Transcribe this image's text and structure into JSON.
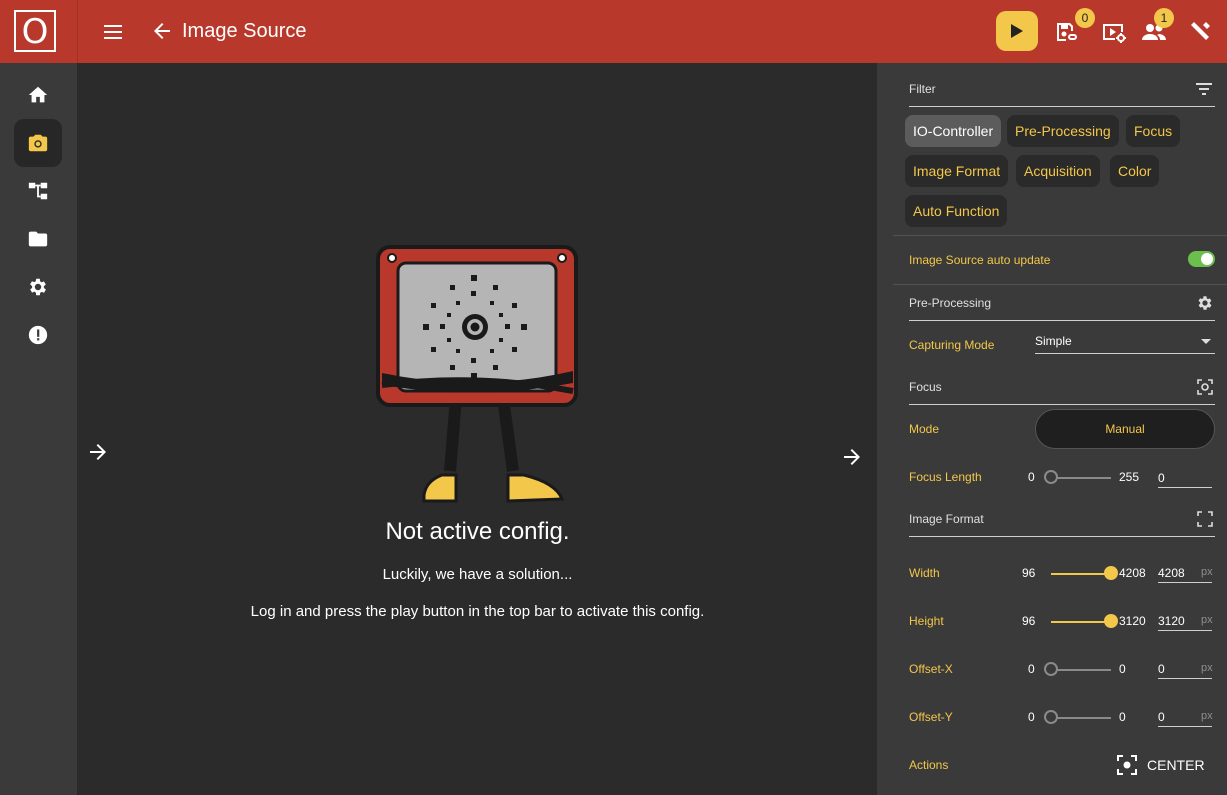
{
  "header": {
    "logo_letter": "O",
    "title": "Image Source",
    "badges": {
      "config_count": "0",
      "users_count": "1"
    },
    "icons": [
      "menu-icon",
      "arrow-back-icon",
      "play-icon",
      "save-config-icon",
      "video-settings-icon",
      "users-icon",
      "tools-icon"
    ]
  },
  "sidebar": {
    "items": [
      {
        "name": "home-icon",
        "active": false
      },
      {
        "name": "camera-icon",
        "active": true
      },
      {
        "name": "tree-icon",
        "active": false
      },
      {
        "name": "folder-icon",
        "active": false
      },
      {
        "name": "gear-icon",
        "active": false
      },
      {
        "name": "alert-icon",
        "active": false
      }
    ]
  },
  "main": {
    "title": "Not active config.",
    "subtitle": "Luckily, we have a solution...",
    "instruction": "Log in and press the play button in the top bar to activate this config."
  },
  "panel": {
    "filter_label": "Filter",
    "chips": [
      "IO-Controller",
      "Pre-Processing",
      "Focus",
      "Image Format",
      "Acquisition",
      "Color",
      "Auto Function"
    ],
    "selected_chip": "IO-Controller",
    "auto_update_label": "Image Source auto update",
    "auto_update_on": true,
    "preprocessing": {
      "section_label": "Pre-Processing",
      "capturing_mode_label": "Capturing Mode",
      "capturing_mode_value": "Simple"
    },
    "focus": {
      "section_label": "Focus",
      "mode_label": "Mode",
      "mode_value": "Manual",
      "focus_length_label": "Focus Length",
      "min": "0",
      "max": "255",
      "value": "0",
      "level": 0
    },
    "image_format": {
      "section_label": "Image Format",
      "rows": [
        {
          "label": "Width",
          "min": "96",
          "max": "4208",
          "value": "4208",
          "unit": "px",
          "level": 1.0
        },
        {
          "label": "Height",
          "min": "96",
          "max": "3120",
          "value": "3120",
          "unit": "px",
          "level": 1.0
        },
        {
          "label": "Offset-X",
          "min": "0",
          "max": "0",
          "value": "0",
          "unit": "px",
          "level": 0
        },
        {
          "label": "Offset-Y",
          "min": "0",
          "max": "0",
          "value": "0",
          "unit": "px",
          "level": 0
        }
      ],
      "actions_label": "Actions",
      "center_label": "CENTER"
    }
  },
  "colors": {
    "header": "#b8392c",
    "accent": "#f3c749",
    "toggle_on": "#6dbf4d"
  }
}
